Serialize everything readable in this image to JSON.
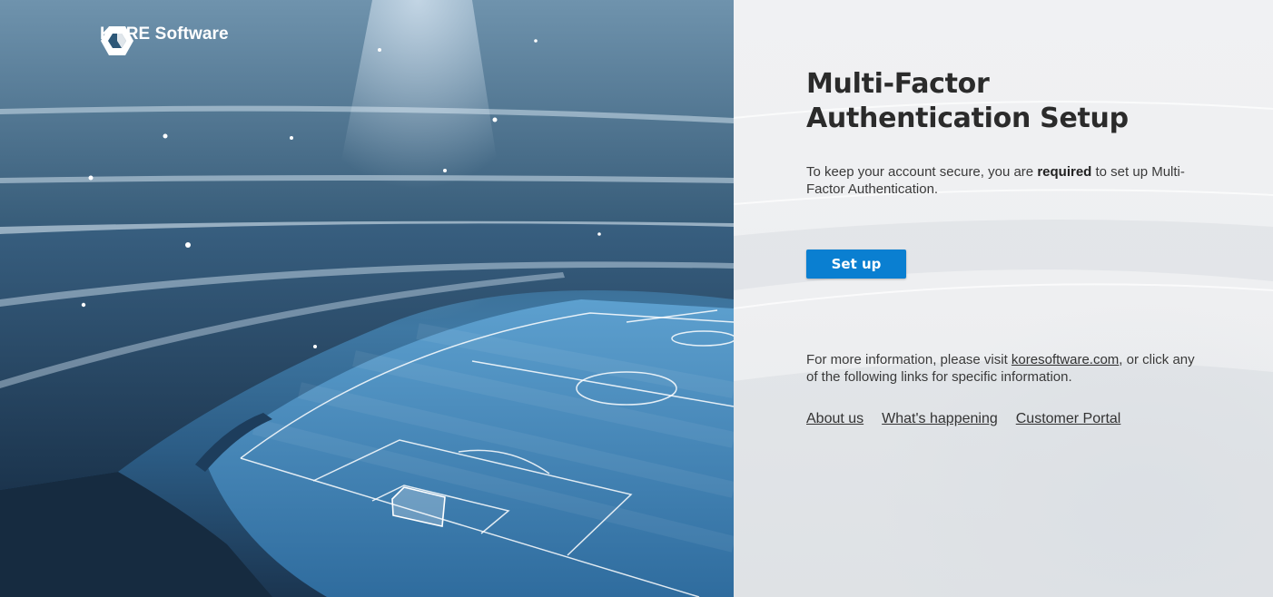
{
  "brand": {
    "name": "KORE Software",
    "logo_icon": "kore-hexagon-logo"
  },
  "hero": {
    "image": "football-stadium-photo"
  },
  "main": {
    "title": "Multi-Factor Authentication Setup",
    "intro_before": "To keep your account secure, you are ",
    "intro_strong": "required",
    "intro_after": " to set up Multi-Factor Authentication.",
    "setup_button": "Set up",
    "info_before": "For more information, please visit ",
    "info_link": "koresoftware.com",
    "info_after": ", or click any of the following links for specific information.",
    "links": [
      "About us",
      "What's happening",
      "Customer Portal"
    ]
  },
  "colors": {
    "accent": "#0a7fd1",
    "panel_bg": "#eeeff1",
    "title_text": "#2b2b2b"
  }
}
